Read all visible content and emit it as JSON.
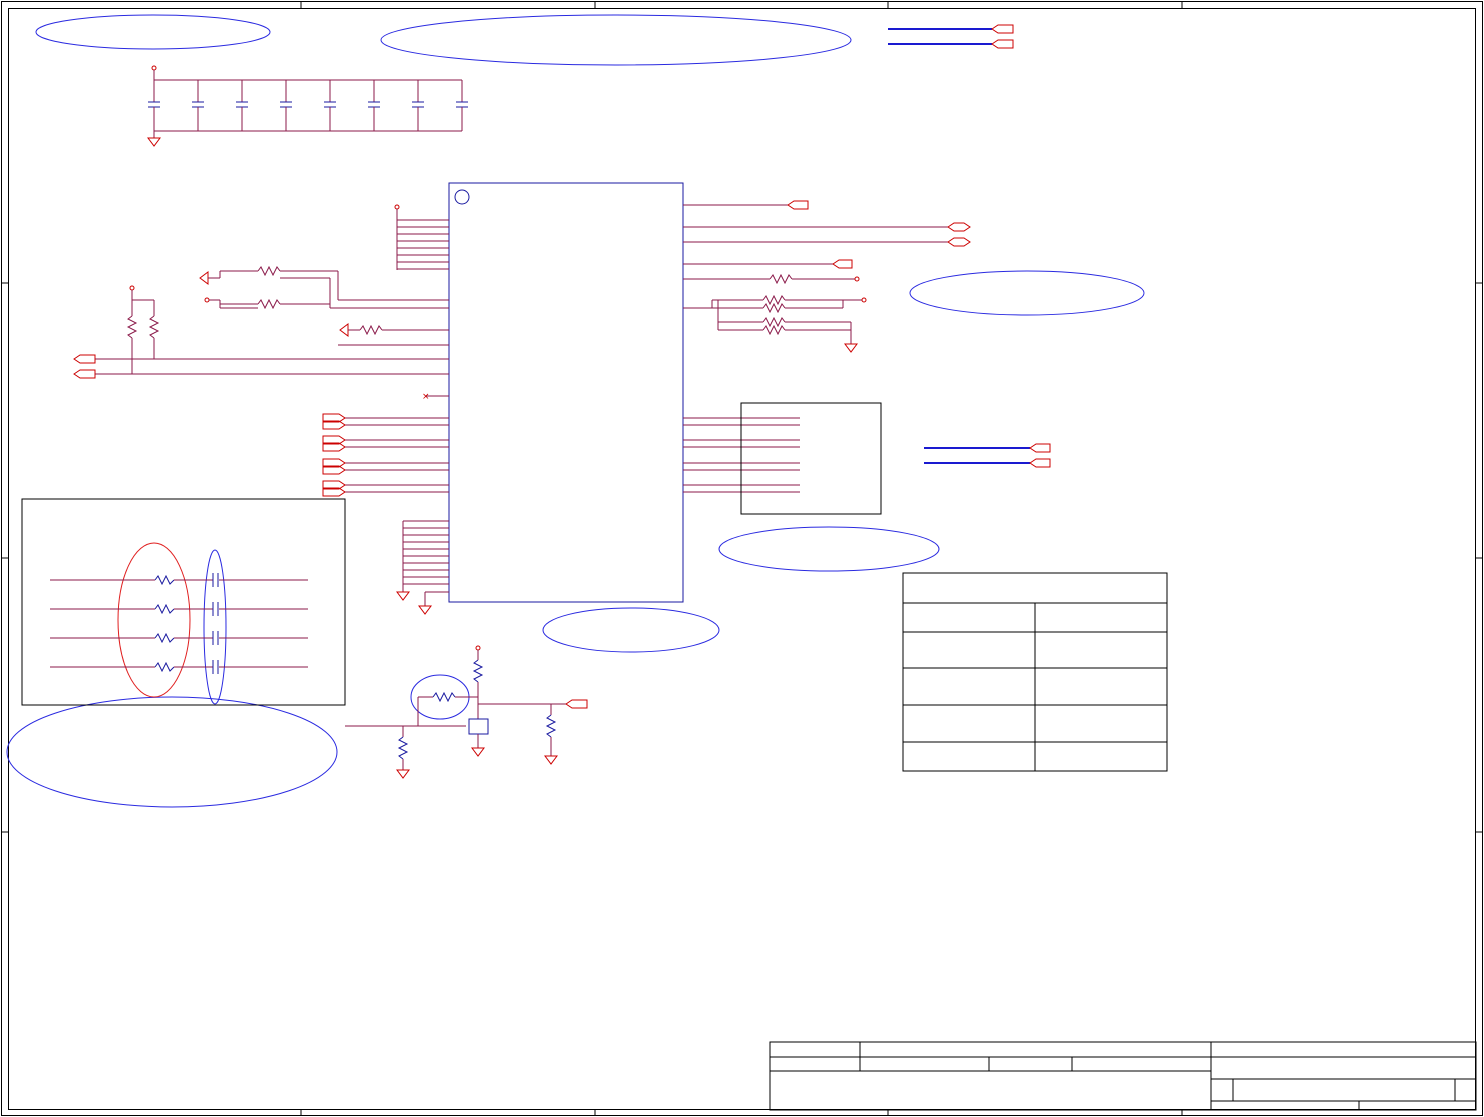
{
  "sheet": {
    "background": "#ffffff",
    "colors": {
      "wire": "#8b1a4a",
      "net_label": "#cc0000",
      "component": "#1a1aa0",
      "annotation": "#2a2ae0",
      "highlight_red": "#e02020",
      "frame": "#000000"
    }
  },
  "title_block": {
    "title": "",
    "sheet_no": "",
    "revision": ""
  },
  "table": {
    "header": "",
    "rows": [
      [
        "",
        ""
      ],
      [
        "",
        ""
      ],
      [
        "",
        ""
      ],
      [
        "",
        ""
      ],
      [
        "",
        ""
      ]
    ]
  }
}
